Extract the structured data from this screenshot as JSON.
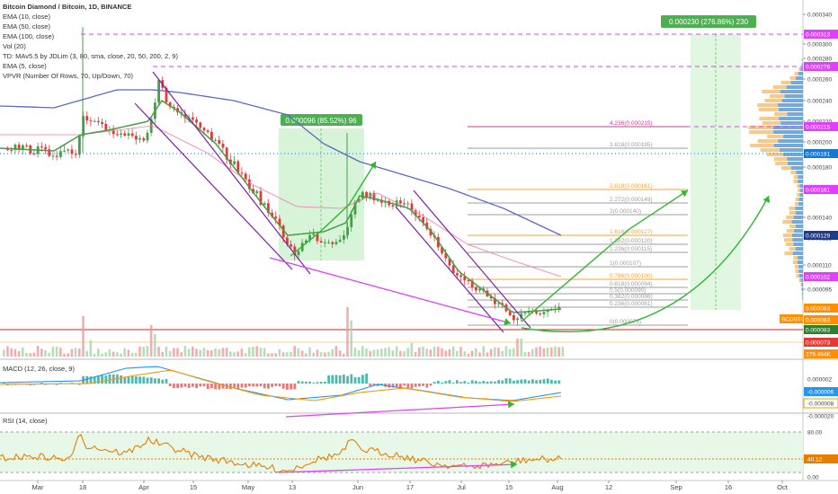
{
  "header": {
    "title": "Bitcoin Diamond / Bitcoin, 1D, BINANCE",
    "indicators": [
      "EMA (10, close)",
      "EMA (50, close)",
      "EMA (100, close)",
      "Vol (20)",
      "TD: MAv5.5 by JDLim (3, 80, sma, close, 20, 50, 200, 2, 9)",
      "EMA (5, close)",
      "VPVR (Number Of Rows, 70, Up/Down, 70)"
    ]
  },
  "panes": {
    "macd_label": "MACD (12, 26, close, 9)",
    "rsi_label": "RSI (14, close)"
  },
  "colors": {
    "ema_short": "#43a047",
    "ema_mid": "#ef7fb3",
    "ema_long": "#5c6bc0",
    "up_candle": "#43a047",
    "down_candle": "#e53935",
    "annotation": "#e040fb",
    "projection": "#2eb82e",
    "channel": "#7b1fa2",
    "rsi_line": "#e67e00",
    "macd_line": "#2196f3",
    "signal_line": "#ff9800"
  },
  "chart_data": [
    {
      "type": "line",
      "pane": "price",
      "y_axis_ticks": [
        "0.000340",
        "0.000300",
        "0.000280",
        "0.000260",
        "0.000240",
        "0.000220",
        "0.000200",
        "0.000180",
        "0.000160",
        "0.000140",
        "0.000125",
        "0.000110",
        "0.000095"
      ],
      "x_axis_ticks": [
        "Mar",
        "18",
        "Apr",
        "15",
        "May",
        "13",
        "Jun",
        "17",
        "Jul",
        "15",
        "Aug",
        "12",
        "Sep",
        "16",
        "Oct"
      ],
      "price_markers": [
        {
          "text": "0.000313",
          "color": "#e040fb"
        },
        {
          "text": "0.000276",
          "color": "#e040fb"
        },
        {
          "text": "0.000215",
          "color": "#e040fb"
        },
        {
          "text": "0.000191",
          "color": "#1976d2"
        },
        {
          "text": "0.000161",
          "color": "#e040fb"
        },
        {
          "text": "0.000129",
          "color": "#1e3a8a"
        },
        {
          "text": "0.000102",
          "color": "#e040fb"
        },
        {
          "text": "0.000083",
          "color": "#ff8f00"
        },
        {
          "text": "BCDBTC",
          "color": "#ff8f00"
        },
        {
          "text": "0.000083",
          "color": "#ff8f00"
        },
        {
          "text": "0.000083",
          "color": "#2e7d32"
        },
        {
          "text": "0.000073",
          "color": "#e53935"
        },
        {
          "text": "279.464K",
          "color": "#ff8f00"
        }
      ],
      "fib_levels": [
        {
          "label": "4.236(0.000215)"
        },
        {
          "label": "3.618(0.000195)"
        },
        {
          "label": "2.618(0.000161)"
        },
        {
          "label": "2.272(0.000149)"
        },
        {
          "label": "2(0.000140)"
        },
        {
          "label": "1.618(0.000127)"
        },
        {
          "label": "1.382(0.000120)"
        },
        {
          "label": "1.236(0.000115)"
        },
        {
          "label": "1(0.000107)"
        },
        {
          "label": "0.786(0.000100)"
        },
        {
          "label": "0.618(0.000094)"
        },
        {
          "label": "0.5(0.000090)"
        },
        {
          "label": "0.382(0.000086)"
        },
        {
          "label": "0.236(0.000081)"
        },
        {
          "label": "0(0.000073)"
        }
      ],
      "measure_boxes": [
        {
          "label": "0.000096 (85.52%) 96"
        },
        {
          "label": "0.000230 (276.86%) 230"
        }
      ],
      "series": [
        {
          "name": "EMA (10, close)"
        },
        {
          "name": "EMA (50, close)"
        },
        {
          "name": "EMA (100, close)"
        }
      ]
    },
    {
      "type": "bar",
      "pane": "macd",
      "title": "MACD (12, 26, close, 9)",
      "y_axis_ticks": [
        "0.000002",
        "-0.000006",
        "-0.000008",
        "-0.000020"
      ]
    },
    {
      "type": "line",
      "pane": "rsi",
      "title": "RSI (14, close)",
      "y_axis_ticks": [
        "80.00",
        "40.12",
        "0.00"
      ],
      "current_value": 40.12
    }
  ]
}
